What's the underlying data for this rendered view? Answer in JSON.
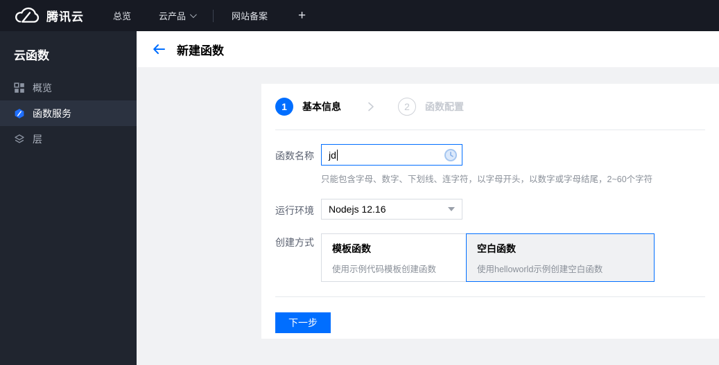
{
  "topnav": {
    "brand": "腾讯云",
    "overview": "总览",
    "products": "云产品",
    "icp": "网站备案",
    "add": "+"
  },
  "sidebar": {
    "title": "云函数",
    "items": [
      {
        "label": "概览",
        "icon": "grid-icon"
      },
      {
        "label": "函数服务",
        "icon": "scf-hexagon-icon"
      },
      {
        "label": "层",
        "icon": "layers-icon"
      }
    ]
  },
  "header": {
    "title": "新建函数",
    "back_icon": "arrow-left-icon"
  },
  "wizard": {
    "steps": [
      {
        "number": "1",
        "label": "基本信息",
        "state": "active"
      },
      {
        "number": "2",
        "label": "函数配置",
        "state": "inactive"
      }
    ]
  },
  "form": {
    "name_label": "函数名称",
    "name_value": "jd",
    "name_status_icon": "clock-icon",
    "name_help": "只能包含字母、数字、下划线、连字符，以字母开头，以数字或字母结尾，2~60个字符",
    "runtime_label": "运行环境",
    "runtime_value": "Nodejs 12.16",
    "method_label": "创建方式",
    "methods": [
      {
        "title": "模板函数",
        "desc": "使用示例代码模板创建函数",
        "selected": false
      },
      {
        "title": "空白函数",
        "desc": "使用helloworld示例创建空白函数",
        "selected": true
      }
    ]
  },
  "actions": {
    "next": "下一步"
  },
  "colors": {
    "accent": "#006eff",
    "topnav_bg": "#171a23",
    "sidebar_bg": "#20252f",
    "sidebar_active_bg": "#2b3240",
    "content_bg": "#f1f2f4",
    "selected_card_bg": "#f0f1f3"
  }
}
